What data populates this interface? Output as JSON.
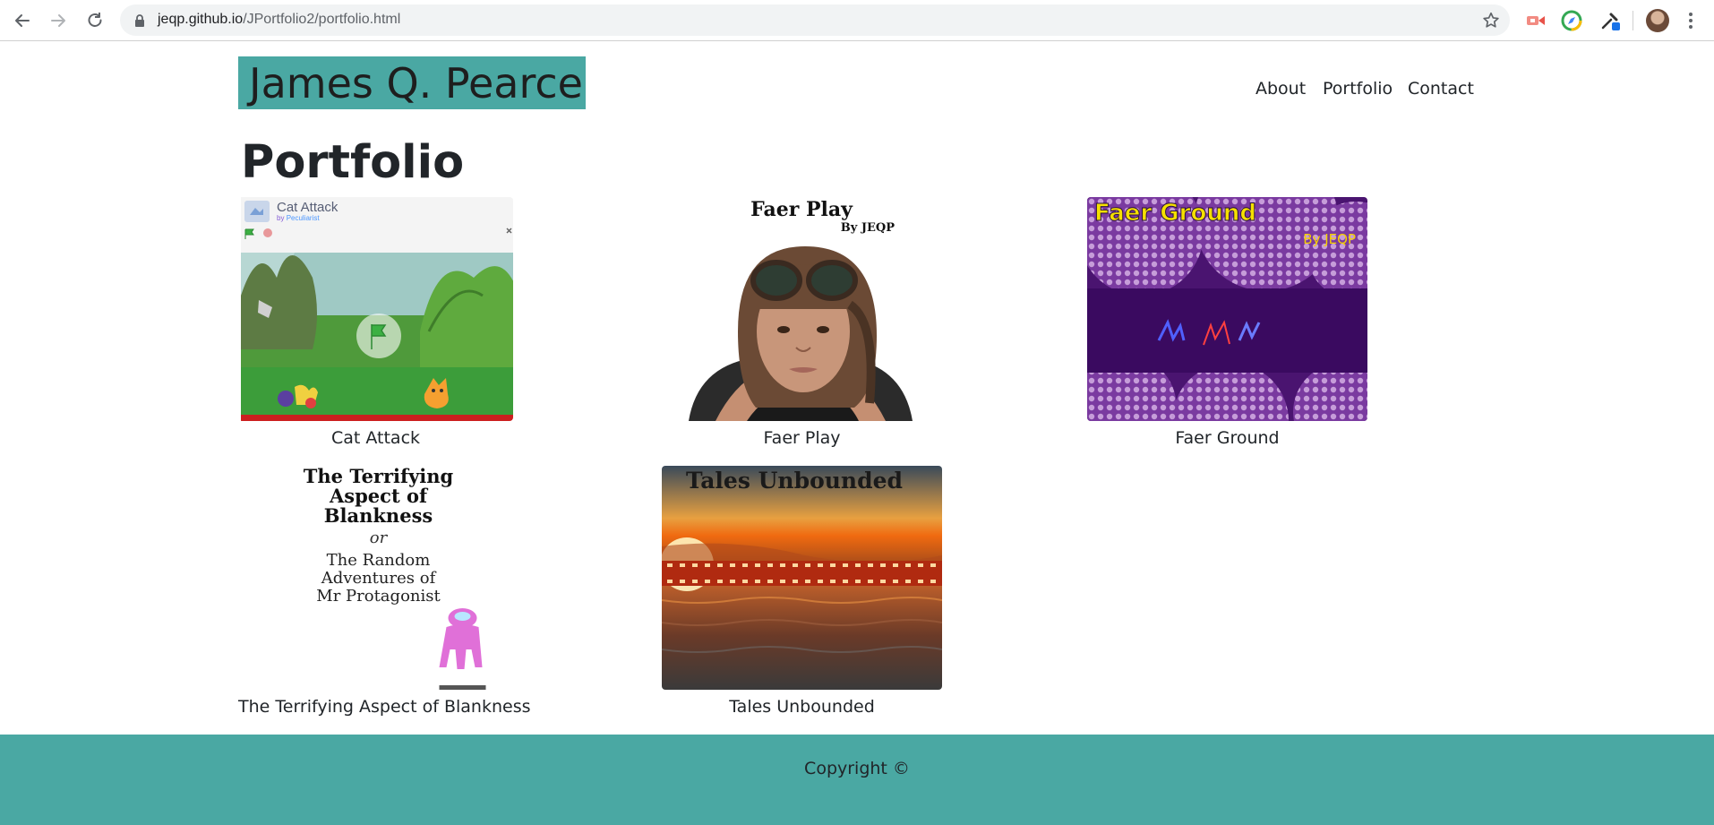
{
  "browser": {
    "url_host": "jeqp.github.io",
    "url_path": "/JPortfolio2/portfolio.html"
  },
  "site": {
    "brand": "James Q. Pearce",
    "nav": [
      "About",
      "Portfolio",
      "Contact"
    ],
    "heading": "Portfolio",
    "accent_color": "#4aa8a3"
  },
  "portfolio": {
    "items": [
      {
        "caption": "Cat Attack",
        "thumb_title": "Cat Attack",
        "thumb_subtitle_by": "by",
        "thumb_subtitle_author": "Peculiarist"
      },
      {
        "caption": "Faer Play",
        "thumb_title": "Faer Play",
        "thumb_subtitle": "By JEQP"
      },
      {
        "caption": "Faer Ground",
        "thumb_title": "Faer Ground",
        "thumb_subtitle": "By JEQP"
      },
      {
        "caption": "The Terrifying Aspect of Blankness",
        "thumb_lines": [
          "The Terrifying",
          "Aspect of",
          "Blankness"
        ],
        "thumb_or": "or",
        "thumb_sub_lines": [
          "The Random",
          "Adventures of",
          "Mr Protagonist"
        ]
      },
      {
        "caption": "Tales Unbounded",
        "thumb_title": "Tales Unbounded"
      }
    ]
  },
  "footer": {
    "text": "Copyright ©"
  }
}
